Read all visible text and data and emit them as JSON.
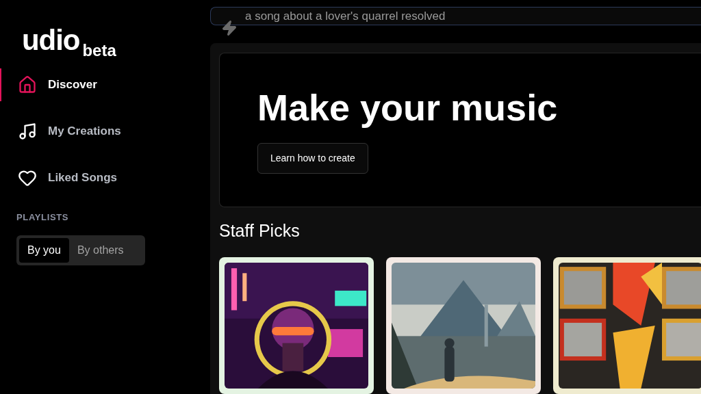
{
  "logo": {
    "name": "udio",
    "tag": "beta"
  },
  "search": {
    "placeholder": "a song about a lover's quarrel resolved"
  },
  "nav": [
    {
      "label": "Discover",
      "selected": true
    },
    {
      "label": "My Creations",
      "selected": false
    },
    {
      "label": "Liked Songs",
      "selected": false
    }
  ],
  "playlists": {
    "heading": "PLAYLISTS",
    "tabs": [
      {
        "label": "By you",
        "selected": true
      },
      {
        "label": "By others",
        "selected": false
      }
    ]
  },
  "hero": {
    "title": "Make your music",
    "button": "Learn how to create"
  },
  "staff_picks": {
    "title": "Staff Picks"
  }
}
